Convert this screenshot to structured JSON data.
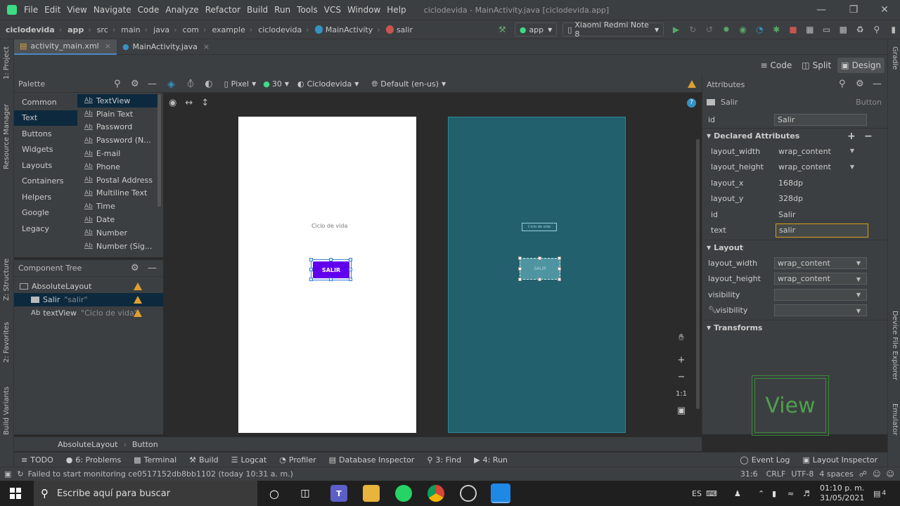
{
  "menu": {
    "items": [
      "File",
      "Edit",
      "View",
      "Navigate",
      "Code",
      "Analyze",
      "Refactor",
      "Build",
      "Run",
      "Tools",
      "VCS",
      "Window",
      "Help"
    ],
    "window_title": "ciclodevida - MainActivity.java [ciclodevida.app]"
  },
  "nav": {
    "breadcrumbs": [
      "ciclodevida",
      "app",
      "src",
      "main",
      "java",
      "com",
      "example",
      "ciclodevida",
      "MainActivity",
      "salir"
    ],
    "run_config": "app",
    "device": "Xiaomi Redmi Note 8"
  },
  "tabs": [
    {
      "label": "activity_main.xml",
      "active": true
    },
    {
      "label": "MainActivity.java",
      "active": false
    }
  ],
  "side": {
    "left": [
      "1: Project",
      "Resource Manager",
      "Z: Structure",
      "2: Favorites",
      "Build Variants"
    ],
    "right": [
      "Gradle",
      "Device File Explorer",
      "Emulator"
    ]
  },
  "view_modes": {
    "code": "Code",
    "split": "Split",
    "design": "Design",
    "active": "Design"
  },
  "palette": {
    "title": "Palette",
    "categories": [
      "Common",
      "Text",
      "Buttons",
      "Widgets",
      "Layouts",
      "Containers",
      "Helpers",
      "Google",
      "Legacy"
    ],
    "selected_category": "Text",
    "items": [
      "TextView",
      "Plain Text",
      "Password",
      "Password (N...",
      "E-mail",
      "Phone",
      "Postal Address",
      "Multiline Text",
      "Time",
      "Date",
      "Number",
      "Number (Sig..."
    ],
    "item_prefix": "Ab"
  },
  "component_tree": {
    "title": "Component Tree",
    "nodes": [
      {
        "label": "AbsoluteLayout",
        "detail": "",
        "level": 0,
        "selected": false,
        "warning": true
      },
      {
        "label": "Salir",
        "detail": "\"salir\"",
        "level": 1,
        "selected": true,
        "warning": true
      },
      {
        "label": "textView",
        "detail": "\"Ciclo de vida\"",
        "level": 1,
        "selected": false,
        "warning": true
      }
    ]
  },
  "design_toolbar": {
    "device": "Pixel",
    "api": "30",
    "theme": "Ciclodevida",
    "locale": "Default (en-us)"
  },
  "preview": {
    "text_label": "Ciclo de vida",
    "button_label": "SALIR",
    "blueprint_text": "Ciclo de vida",
    "blueprint_button": "SALIR",
    "button_color": "#6200ee",
    "blueprint_bg": "#22606d"
  },
  "zoom": {
    "fit_label": "1:1"
  },
  "attributes": {
    "title": "Attributes",
    "component_name": "Salir",
    "component_type": "Button",
    "id_label": "id",
    "id_value": "Salir",
    "declared_title": "Declared Attributes",
    "declared": [
      {
        "name": "layout_width",
        "value": "wrap_content",
        "dropdown": true
      },
      {
        "name": "layout_height",
        "value": "wrap_content",
        "dropdown": true
      },
      {
        "name": "layout_x",
        "value": "168dp",
        "dropdown": false
      },
      {
        "name": "layout_y",
        "value": "328dp",
        "dropdown": false
      },
      {
        "name": "id",
        "value": "Salir",
        "dropdown": false
      },
      {
        "name": "text",
        "value": "salir",
        "dropdown": false
      }
    ],
    "layout_title": "Layout",
    "layout": [
      {
        "name": "layout_width",
        "value": "wrap_content"
      },
      {
        "name": "layout_height",
        "value": "wrap_content"
      },
      {
        "name": "visibility",
        "value": ""
      },
      {
        "name": "visibility",
        "value": ""
      }
    ],
    "transforms_title": "Transforms",
    "transform_preview": "View"
  },
  "bottom_breadcrumb": [
    "AbsoluteLayout",
    "Button"
  ],
  "bottom_tools": [
    "TODO",
    "6: Problems",
    "Terminal",
    "Build",
    "Logcat",
    "Profiler",
    "Database Inspector",
    "3: Find",
    "4: Run"
  ],
  "bottom_right_tools": [
    "Event Log",
    "Layout Inspector"
  ],
  "status": {
    "message": "Failed to start monitoring ce0517152db8bb1102 (today 10:31 a. m.)",
    "position": "31:6",
    "line_sep": "CRLF",
    "encoding": "UTF-8",
    "indent": "4 spaces"
  },
  "taskbar": {
    "search_placeholder": "Escribe aquí para buscar",
    "lang": "ES",
    "time": "01:10 p. m.",
    "date": "31/05/2021",
    "notifications": "4"
  }
}
